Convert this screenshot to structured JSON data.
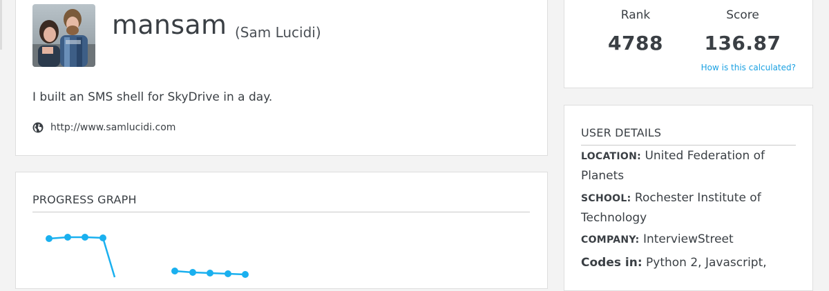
{
  "profile": {
    "username": "mansam",
    "full_name": "(Sam Lucidi)",
    "bio": "I built an SMS shell for SkyDrive in a day.",
    "website": "http://www.samlucidi.com",
    "website_icon": "globe-icon"
  },
  "stats": {
    "rank_label": "Rank",
    "rank_value": "4788",
    "score_label": "Score",
    "score_value": "136.87",
    "calc_link": "How is this calculated?"
  },
  "user_details": {
    "title": "USER DETAILS",
    "location_label": "LOCATION:",
    "location_value": "United Federation of Planets",
    "school_label": "SCHOOL:",
    "school_value": "Rochester Institute of Technology",
    "company_label": "COMPANY:",
    "company_value": "InterviewStreet",
    "codes_label": "Codes in:",
    "codes_value": "Python 2, Javascript,"
  },
  "progress_graph": {
    "title": "PROGRESS GRAPH",
    "line_color": "#1ab0ef"
  }
}
